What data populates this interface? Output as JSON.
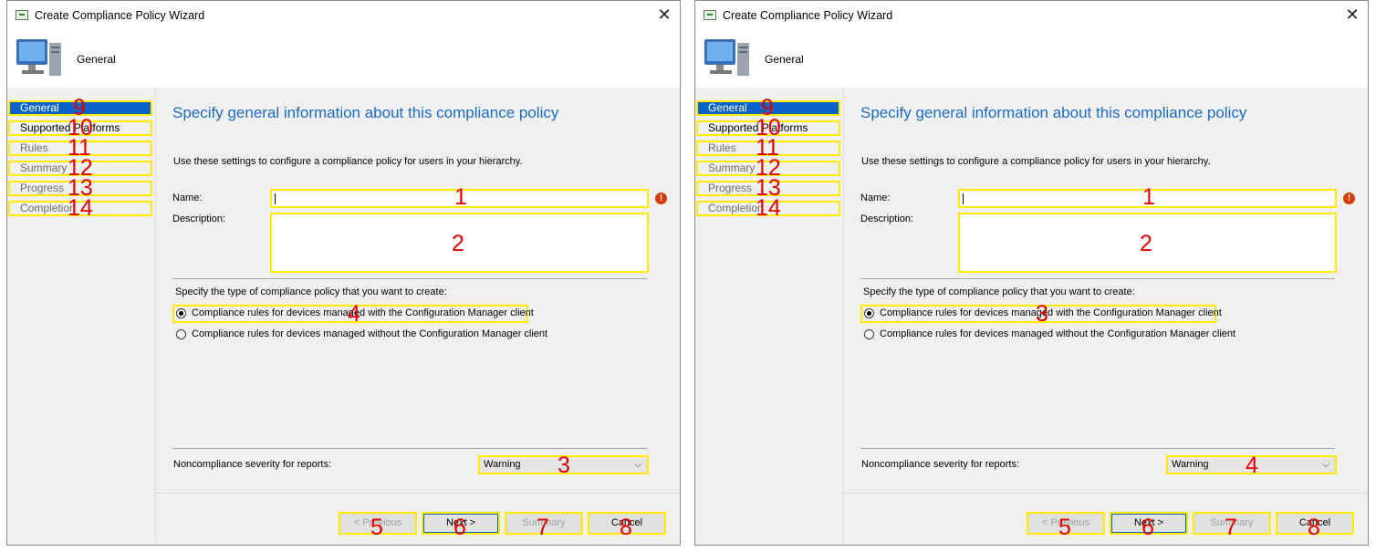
{
  "windows": [
    {
      "title": "Create Compliance Policy Wizard",
      "header_title": "General",
      "nav": [
        {
          "label": "General",
          "num": "9"
        },
        {
          "label": "Supported Platforms",
          "num": "10"
        },
        {
          "label": "Rules",
          "num": "11"
        },
        {
          "label": "Summary",
          "num": "12"
        },
        {
          "label": "Progress",
          "num": "13"
        },
        {
          "label": "Completion",
          "num": "14"
        }
      ],
      "content_title": "Specify general information about this compliance policy",
      "intro": "Use these settings to configure a compliance policy for users in your hierarchy.",
      "name_label": "Name:",
      "name_value": "",
      "name_num": "1",
      "desc_label": "Description:",
      "desc_value": "",
      "desc_num": "2",
      "type_label": "Specify the type of compliance policy that you want to create:",
      "radio_managed": "Compliance rules for devices managed with the Configuration Manager client",
      "radio_managed_num": "4",
      "radio_unmanaged": "Compliance rules for devices managed without the Configuration Manager client",
      "severity_label": "Noncompliance severity for reports:",
      "severity_value": "Warning",
      "severity_num": "3",
      "buttons": {
        "previous": "< Previous",
        "previous_num": "5",
        "next": "Next >",
        "next_num": "6",
        "summary": "Summary",
        "summary_num": "7",
        "cancel": "Cancel",
        "cancel_num": "8"
      }
    },
    {
      "title": "Create Compliance Policy Wizard",
      "header_title": "General",
      "nav": [
        {
          "label": "General",
          "num": "9"
        },
        {
          "label": "Supported Platforms",
          "num": "10"
        },
        {
          "label": "Rules",
          "num": "11"
        },
        {
          "label": "Summary",
          "num": "12"
        },
        {
          "label": "Progress",
          "num": "13"
        },
        {
          "label": "Completion",
          "num": "14"
        }
      ],
      "content_title": "Specify general information about this compliance policy",
      "intro": "Use these settings to configure a compliance policy for users in your hierarchy.",
      "name_label": "Name:",
      "name_value": "",
      "name_num": "1",
      "desc_label": "Description:",
      "desc_value": "",
      "desc_num": "2",
      "type_label": "Specify the type of compliance policy that you want to create:",
      "radio_managed": "Compliance rules for devices managed with the Configuration Manager client",
      "radio_managed_num": "3",
      "radio_unmanaged": "Compliance rules for devices managed without the Configuration Manager client",
      "severity_label": "Noncompliance severity for reports:",
      "severity_value": "Warning",
      "severity_num": "4",
      "buttons": {
        "previous": "< Previous",
        "previous_num": "5",
        "next": "Next >",
        "next_num": "6",
        "summary": "Summary",
        "summary_num": "7",
        "cancel": "Cancel",
        "cancel_num": "8"
      }
    }
  ],
  "colors": {
    "accent": "#0a64c8",
    "title_blue": "#1c6bc2",
    "highlight": "#ffea00",
    "annotation": "#e00000",
    "error": "#d83b01"
  },
  "icons": [
    "wizard-title-icon",
    "close-icon",
    "computer-icon",
    "error-icon",
    "chevron-down-icon"
  ]
}
